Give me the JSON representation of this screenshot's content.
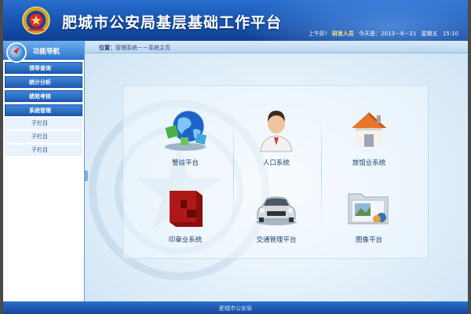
{
  "header": {
    "title": "肥城市公安局基层基础工作平台",
    "greeting": "上午好!",
    "user": "研发人员",
    "today_label": "今天是：",
    "date": "2013－6－21",
    "weekday": "星期五",
    "time": "15:10"
  },
  "sidebar": {
    "title": "功能导航",
    "menus": [
      {
        "label": "领导查询"
      },
      {
        "label": "统计分析"
      },
      {
        "label": "绩效考核"
      },
      {
        "label": "系统管理"
      }
    ],
    "sub_items": [
      {
        "label": "子栏目"
      },
      {
        "label": "子栏目"
      },
      {
        "label": "子栏目"
      }
    ]
  },
  "breadcrumb": {
    "label": "位置：",
    "path": "管理系统－－系统主页"
  },
  "tiles": [
    {
      "label": "警综平台",
      "icon": "globe-network-icon"
    },
    {
      "label": "人口系统",
      "icon": "person-icon"
    },
    {
      "label": "旅馆业系统",
      "icon": "house-icon"
    },
    {
      "label": "印章业系统",
      "icon": "red-seal-icon"
    },
    {
      "label": "交通管理平台",
      "icon": "car-icon"
    },
    {
      "label": "图像平台",
      "icon": "image-folder-icon"
    }
  ],
  "footer": {
    "text": "肥城市公安局"
  },
  "colors": {
    "header_blue": "#1957b4",
    "menu_blue": "#1c5cb2",
    "sub_item_bg": "#eaf3fc",
    "house_orange": "#e8742a",
    "seal_red": "#b01818"
  }
}
